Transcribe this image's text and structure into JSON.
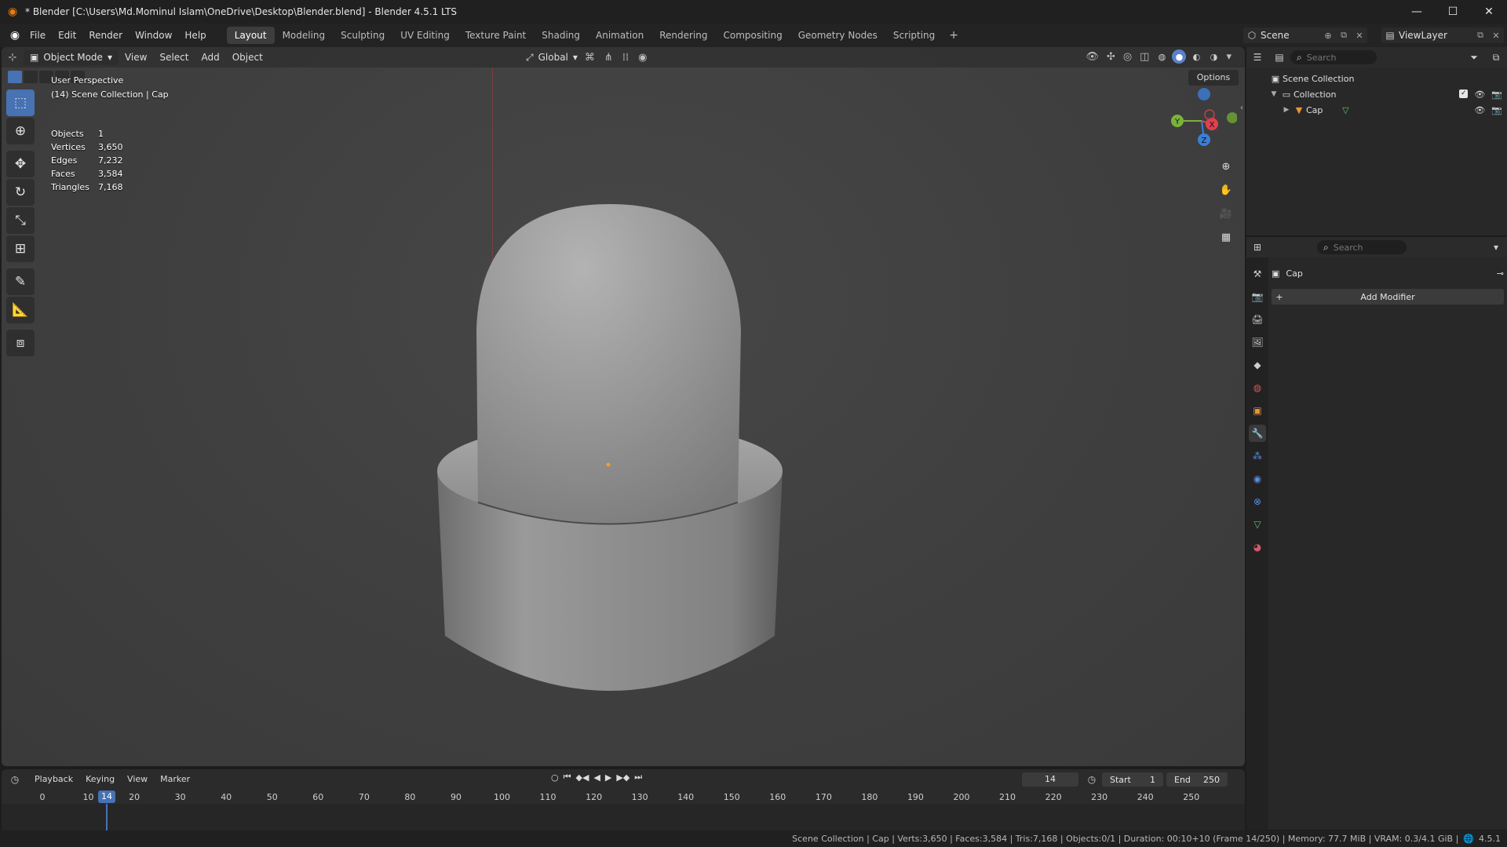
{
  "window": {
    "title": "* Blender [C:\\Users\\Md.Mominul Islam\\OneDrive\\Desktop\\Blender.blend] - Blender 4.5.1 LTS",
    "minimize": "—",
    "maximize": "☐",
    "close": "✕"
  },
  "menubar": {
    "items": [
      "File",
      "Edit",
      "Render",
      "Window",
      "Help"
    ],
    "workspaces": [
      "Layout",
      "Modeling",
      "Sculpting",
      "UV Editing",
      "Texture Paint",
      "Shading",
      "Animation",
      "Rendering",
      "Compositing",
      "Geometry Nodes",
      "Scripting"
    ],
    "active_workspace": "Layout",
    "add_workspace": "+",
    "scene": "Scene",
    "view_layer": "ViewLayer"
  },
  "viewport": {
    "mode": "Object Mode",
    "menus": [
      "View",
      "Select",
      "Add",
      "Object"
    ],
    "orientation": "Global",
    "options": "Options",
    "perspective": "User Perspective",
    "context": "(14) Scene Collection | Cap",
    "stats": [
      {
        "label": "Objects",
        "value": "1"
      },
      {
        "label": "Vertices",
        "value": "3,650"
      },
      {
        "label": "Edges",
        "value": "7,232"
      },
      {
        "label": "Faces",
        "value": "3,584"
      },
      {
        "label": "Triangles",
        "value": "7,168"
      }
    ],
    "gizmo_labels": {
      "x": "X",
      "y": "Y",
      "z": "Z"
    },
    "colors": {
      "x_axis": "#e0404f",
      "y_axis": "#7bb33a",
      "z_axis": "#3b7ed8",
      "accent": "#4772b3"
    }
  },
  "outliner": {
    "search_placeholder": "Search",
    "rows": [
      {
        "label": "Scene Collection"
      },
      {
        "label": "Collection"
      },
      {
        "label": "Cap"
      }
    ]
  },
  "properties": {
    "search_placeholder": "Search",
    "object_name": "Cap",
    "add_modifier": "Add Modifier"
  },
  "timeline": {
    "menus": [
      "Playback",
      "Keying",
      "View",
      "Marker"
    ],
    "current_frame": "14",
    "start_label": "Start",
    "start_value": "1",
    "end_label": "End",
    "end_value": "250",
    "ticks": [
      "0",
      "10",
      "20",
      "30",
      "40",
      "50",
      "60",
      "70",
      "80",
      "90",
      "100",
      "110",
      "120",
      "130",
      "140",
      "150",
      "160",
      "170",
      "180",
      "190",
      "200",
      "210",
      "220",
      "230",
      "240",
      "250"
    ]
  },
  "statusbar": {
    "text": "Scene Collection | Cap | Verts:3,650 | Faces:3,584 | Tris:7,168 | Objects:0/1 | Duration: 00:10+10 (Frame 14/250) | Memory: 77.7 MiB | VRAM: 0.3/4.1 GiB |",
    "version": "4.5.1"
  }
}
